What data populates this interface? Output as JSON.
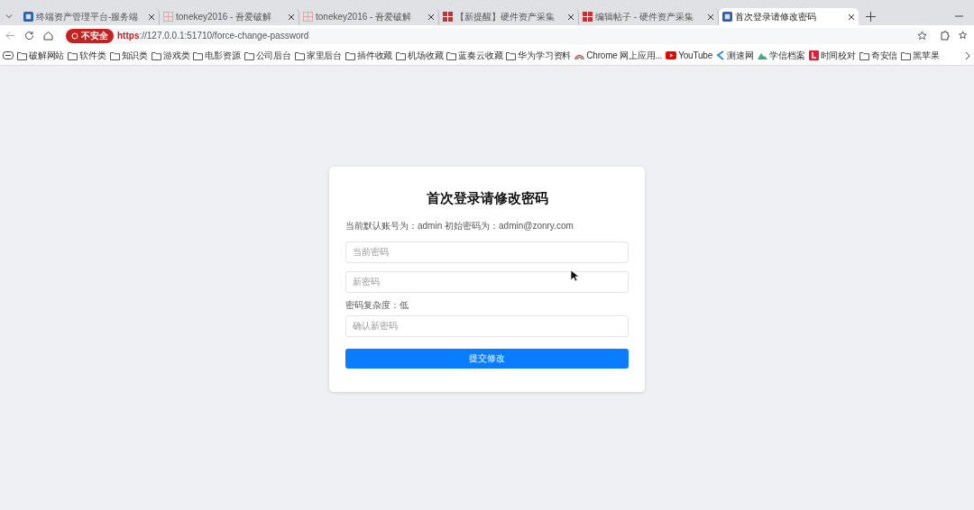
{
  "tabs": [
    {
      "title": "终端资产管理平台-服务端",
      "kind": "app",
      "selected": false
    },
    {
      "title": "tonekey2016 - 吾爱破解",
      "kind": "grid",
      "selected": false
    },
    {
      "title": "tonekey2016 - 吾爱破解",
      "kind": "grid",
      "selected": false
    },
    {
      "title": "【新提醒】硬件资产采集",
      "kind": "redgrid",
      "selected": false
    },
    {
      "title": "编辑帖子 - 硬件资产采集",
      "kind": "redgrid",
      "selected": false
    },
    {
      "title": "首次登录请修改密码",
      "kind": "app",
      "selected": true
    }
  ],
  "address_bar": {
    "security_badge": "不安全",
    "scheme": "https",
    "rest": "://127.0.0.1:51710/force-change-password"
  },
  "bookmarks": [
    {
      "label": "破解网站",
      "kind": "folder"
    },
    {
      "label": "软件类",
      "kind": "folder"
    },
    {
      "label": "知识类",
      "kind": "folder"
    },
    {
      "label": "游戏类",
      "kind": "folder"
    },
    {
      "label": "电影资源",
      "kind": "folder"
    },
    {
      "label": "公司后台",
      "kind": "folder"
    },
    {
      "label": "家里后台",
      "kind": "folder"
    },
    {
      "label": "插件收藏",
      "kind": "folder"
    },
    {
      "label": "机场收藏",
      "kind": "folder"
    },
    {
      "label": "蓝奏云收藏",
      "kind": "folder"
    },
    {
      "label": "华为学习资料",
      "kind": "folder"
    },
    {
      "label": "Chrome 网上应用...",
      "kind": "rainbow"
    },
    {
      "label": "YouTube",
      "kind": "play"
    },
    {
      "label": "测速网",
      "kind": "swirl"
    },
    {
      "label": "学信档案",
      "kind": "cloud"
    },
    {
      "label": "时间校对",
      "kind": "square"
    },
    {
      "label": "奇安信",
      "kind": "folder"
    },
    {
      "label": "黑苹果",
      "kind": "folder"
    }
  ],
  "form": {
    "title": "首次登录请修改密码",
    "info": "当前默认账号为：admin 初始密码为：admin@zonry.com",
    "fields": [
      {
        "placeholder": "当前密码"
      },
      {
        "placeholder": "新密码"
      },
      {
        "placeholder": "确认新密码"
      }
    ],
    "strength": "密码复杂度：低",
    "submit": "提交修改"
  }
}
